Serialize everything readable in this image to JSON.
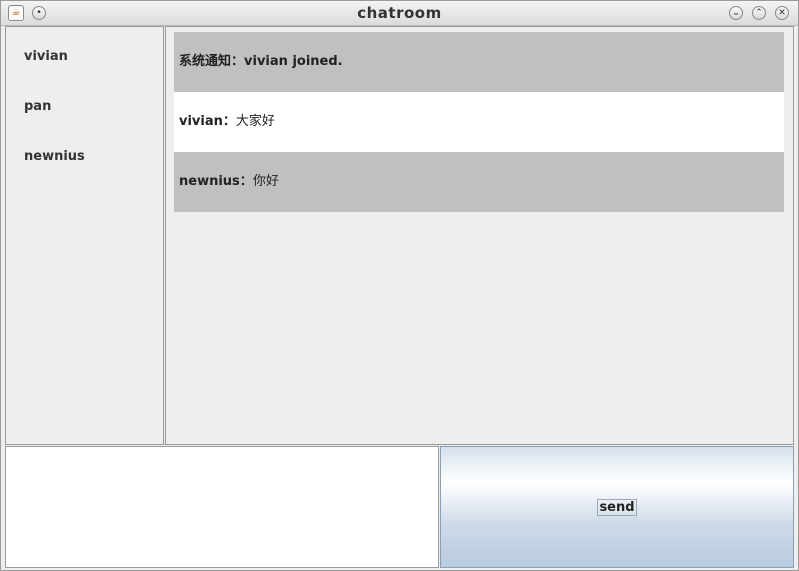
{
  "window": {
    "title": "chatroom"
  },
  "users": [
    "vivian",
    "pan",
    "newnius"
  ],
  "messages": [
    {
      "sender": "系统通知",
      "separator": "：",
      "text": "vivian joined.",
      "bg": "#c0c0c0",
      "bold_text": true
    },
    {
      "sender": "vivian",
      "separator": "：",
      "text": "大家好",
      "bg": "#ffffff",
      "bold_text": false
    },
    {
      "sender": "newnius",
      "separator": "：",
      "text": "你好",
      "bg": "#c0c0c0",
      "bold_text": false
    }
  ],
  "input": {
    "value": ""
  },
  "send_button": {
    "label": "send"
  },
  "colors": {
    "alt_row": "#c0c0c0",
    "panel": "#eeeeee",
    "button_gradient": "#b8cbe0"
  }
}
